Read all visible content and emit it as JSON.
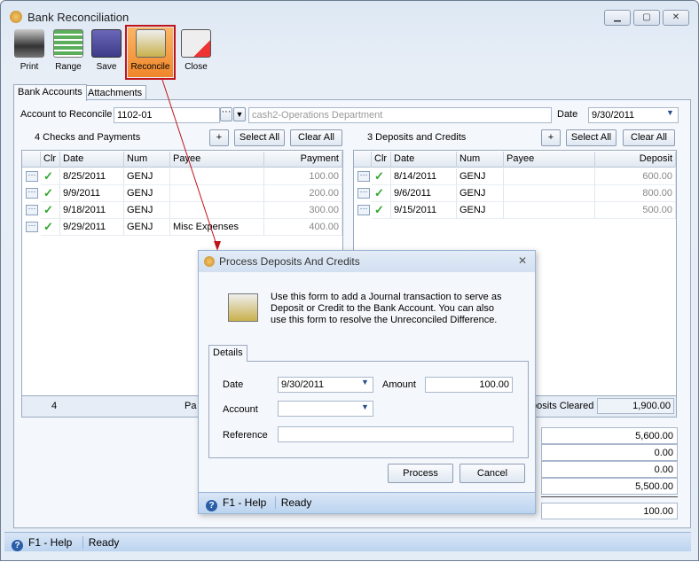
{
  "window": {
    "title": "Bank Reconciliation",
    "controls": [
      "minimize",
      "maximize",
      "close"
    ]
  },
  "toolbar": [
    {
      "label": "Print",
      "icon": "printer-icon"
    },
    {
      "label": "Range",
      "icon": "range-icon"
    },
    {
      "label": "Save",
      "icon": "floppy-icon"
    },
    {
      "label": "Reconcile",
      "icon": "bank-icon",
      "active": true
    },
    {
      "label": "Close",
      "icon": "close-form-icon"
    }
  ],
  "tabs": [
    "Bank Accounts",
    "Attachments"
  ],
  "account": {
    "label": "Account to Reconcile",
    "value": "1102-01",
    "description": "cash2-Operations Department",
    "date_label": "Date",
    "date": "9/30/2011"
  },
  "checks": {
    "title": "4  Checks and Payments",
    "add": "+",
    "select_all": "Select All",
    "clear_all": "Clear All",
    "columns": [
      "Clr",
      "Date",
      "Num",
      "Payee",
      "Payment"
    ],
    "rows": [
      [
        "8/25/2011",
        "GENJ",
        "",
        "100.00"
      ],
      [
        "9/9/2011",
        "GENJ",
        "",
        "200.00"
      ],
      [
        "9/18/2011",
        "GENJ",
        "",
        "300.00"
      ],
      [
        "9/29/2011",
        "GENJ",
        "Misc Expenses",
        "400.00"
      ]
    ],
    "footer_count": "4",
    "footer_label": "Pa"
  },
  "deposits": {
    "title": "3  Deposits and Credits",
    "add": "+",
    "select_all": "Select All",
    "clear_all": "Clear All",
    "columns": [
      "Clr",
      "Date",
      "Num",
      "Payee",
      "Deposit"
    ],
    "rows": [
      [
        "8/14/2011",
        "GENJ",
        "",
        "600.00"
      ],
      [
        "9/6/2011",
        "GENJ",
        "",
        "800.00"
      ],
      [
        "9/15/2011",
        "GENJ",
        "",
        "500.00"
      ]
    ],
    "footer_label": "posits Cleared",
    "footer_total": "1,900.00"
  },
  "totals": [
    "5,600.00",
    "0.00",
    "0.00",
    "5,500.00"
  ],
  "difference": "100.00",
  "dialog": {
    "title": "Process Deposits And Credits",
    "description": "Use this form to add a Journal transaction to serve as Deposit or Credit to the Bank Account. You can also use this form to resolve the Unreconciled Difference.",
    "tab": "Details",
    "date_label": "Date",
    "date": "9/30/2011",
    "amount_label": "Amount",
    "amount": "100.00",
    "account_label": "Account",
    "account": "",
    "reference_label": "Reference",
    "reference": "",
    "process": "Process",
    "cancel": "Cancel",
    "help": "F1 - Help",
    "status": "Ready"
  },
  "status": {
    "help": "F1 - Help",
    "text": "Ready"
  },
  "colors": {
    "accent": "#f59a3c",
    "highlight_border": "#c0141c",
    "check": "#2ea82e"
  }
}
